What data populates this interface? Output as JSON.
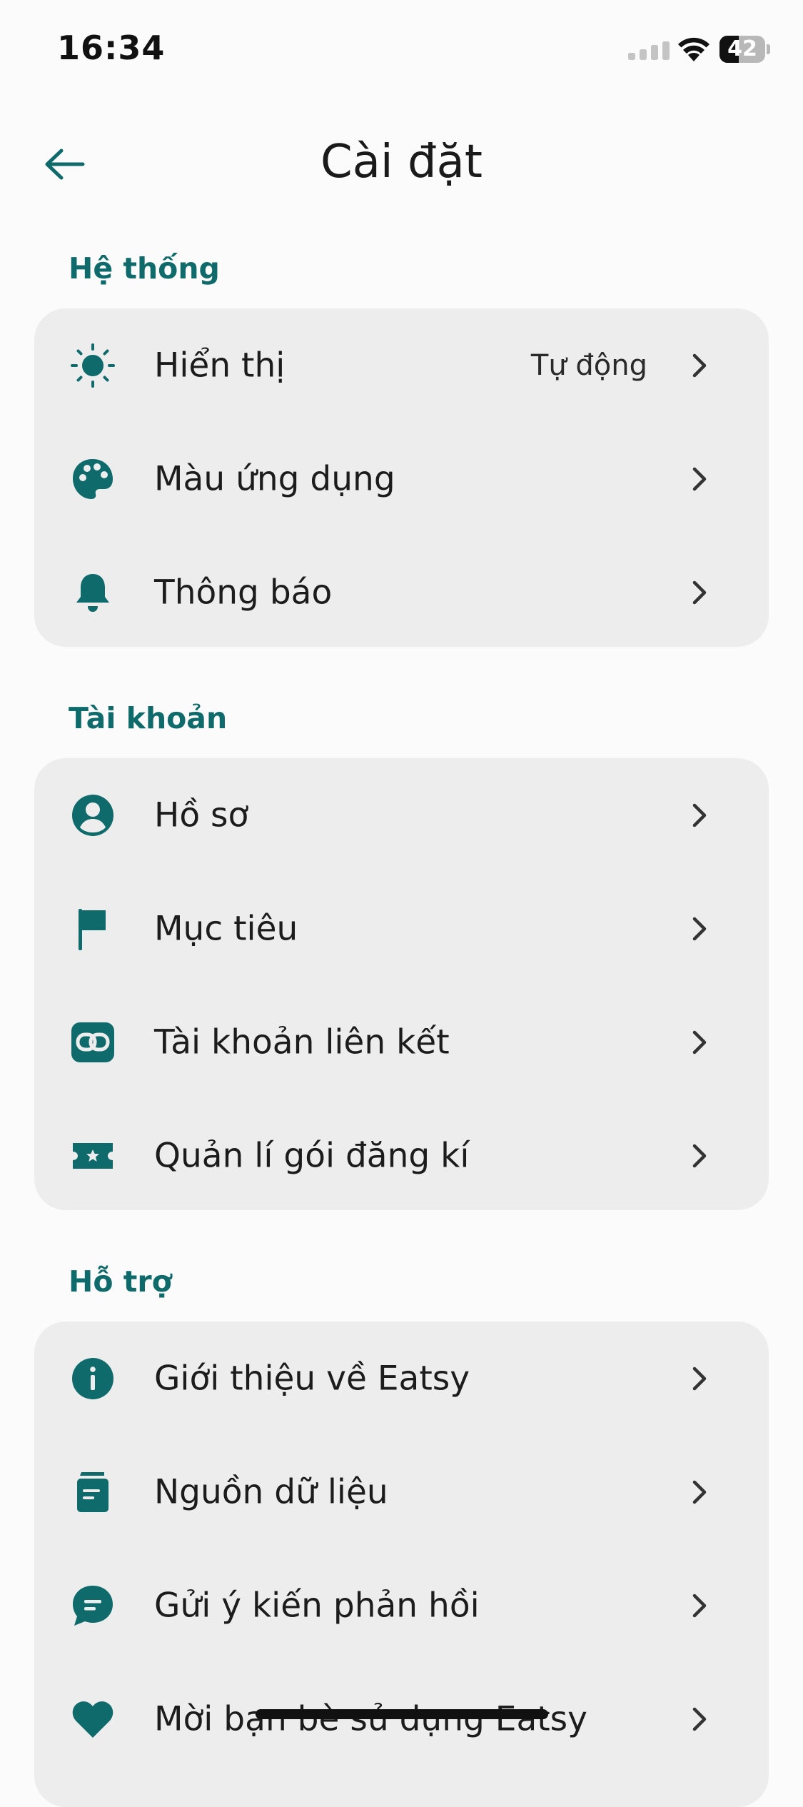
{
  "status_bar": {
    "time": "16:34",
    "battery_level": "42",
    "battery_fraction": 0.42
  },
  "header": {
    "title": "Cài đặt",
    "back_icon": "arrow-left-icon"
  },
  "colors": {
    "accent": "#0f6b6b",
    "background": "#fbfbfb",
    "card": "#ededed",
    "text": "#1c1c1c"
  },
  "sections": [
    {
      "title": "Hệ thống",
      "items": [
        {
          "label": "Hiển thị",
          "value": "Tự động",
          "icon": "brightness-icon"
        },
        {
          "label": "Màu ứng dụng",
          "icon": "palette-icon"
        },
        {
          "label": "Thông báo",
          "icon": "bell-icon"
        }
      ]
    },
    {
      "title": "Tài khoản",
      "items": [
        {
          "label": "Hồ sơ",
          "icon": "profile-icon"
        },
        {
          "label": "Mục tiêu",
          "icon": "flag-icon"
        },
        {
          "label": "Tài khoản liên kết",
          "icon": "link-icon"
        },
        {
          "label": "Quản lí gói đăng kí",
          "icon": "ticket-icon"
        }
      ]
    },
    {
      "title": "Hỗ trợ",
      "items": [
        {
          "label": "Giới thiệu về Eatsy",
          "icon": "info-icon"
        },
        {
          "label": "Nguồn dữ liệu",
          "icon": "book-icon"
        },
        {
          "label": "Gửi ý kiến phản hồi",
          "icon": "feedback-icon"
        },
        {
          "label": "Mời bạn bè sử dụng Eatsy",
          "icon": "heart-icon"
        }
      ]
    }
  ]
}
